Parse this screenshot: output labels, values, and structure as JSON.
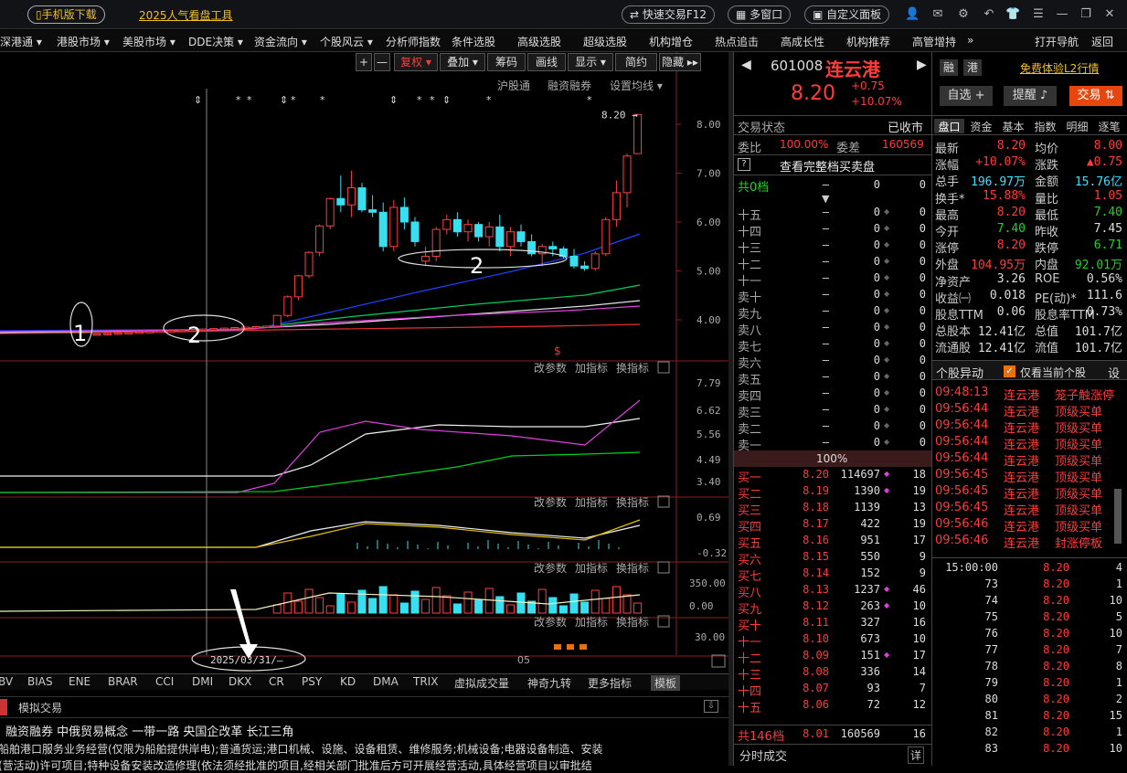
{
  "topbar": {
    "mobile_download": "手机版下载",
    "hot_tool": "2025人气看盘工具",
    "quick_trade": "快速交易F12",
    "multi_window": "多窗口",
    "custom_panel": "自定义面板"
  },
  "menu": [
    "深港通 ▾",
    "港股市场 ▾",
    "美股市场 ▾",
    "DDE决策 ▾",
    "资金流向 ▾",
    "个股风云 ▾",
    "分析师指数",
    "条件选股",
    "高级选股",
    "超级选股",
    "机构增仓",
    "热点追击",
    "高成长性",
    "机构推荐",
    "高管增持"
  ],
  "menu_more": "»",
  "open_nav": "打开导航",
  "back": "返回",
  "toolbar": [
    "复权 ▾",
    "叠加 ▾",
    "筹码",
    "画线",
    "显示 ▾",
    "简约",
    "隐藏 ▸▸"
  ],
  "chart_top_labels": {
    "hgt": "沪股通",
    "rzrq": "融资融券",
    "ma_setting": "设置均线 ▾"
  },
  "sub_labels": [
    "改参数",
    "加指标",
    "换指标"
  ],
  "price_axis": [
    "8.00",
    "7.00",
    "6.00",
    "5.00",
    "4.00"
  ],
  "current_price_label": "8.20",
  "ind1_axis": [
    "7.79",
    "6.62",
    "5.56",
    "4.49",
    "3.40"
  ],
  "ind2_axis": [
    "0.69",
    "-0.32"
  ],
  "ind3_axis": [
    "350.00",
    "0.00"
  ],
  "ind4_axis": [
    "30.00"
  ],
  "annotations": {
    "a1": "1",
    "a2": "2",
    "a3": "2"
  },
  "date_axis": {
    "start": "2025/03/31/—",
    "mid": "05"
  },
  "bottom_tabs": [
    "BV",
    "BIAS",
    "ENE",
    "BRAR",
    "CCI",
    "DMI",
    "DKX",
    "CR",
    "PSY",
    "KD",
    "DMA",
    "TRIX",
    "虚拟成交量",
    "神奇九转",
    "更多指标",
    "模板"
  ],
  "lower": {
    "tab": "模拟交易",
    "concepts": "融资融券  中俄贸易概念  一带一路  央国企改革  长江三角",
    "business": "船舶港口服务业务经营(仅限为船舶提供岸电);普通货运;港口机械、设施、设备租赁、维修服务;机械设备;电器设备制造、安装",
    "business2": "(营活动)许可项目;特种设备安装改造修理(依法须经批准的项目,经相关部门批准后方可开展经营活动,具体经营项目以审批结"
  },
  "stock": {
    "code": "601008",
    "name": "连云港",
    "price": "8.20",
    "change": "+0.75",
    "pct": "+10.07%",
    "free_l2": "免费体验L2行情",
    "rong": "融",
    "gang": "港",
    "zixuan": "自选 +",
    "tixing": "提醒",
    "jiaoyi": "交易"
  },
  "status": {
    "label": "交易状态",
    "value": "已收市",
    "weibi_l": "委比",
    "weibi": "100.00%",
    "weicha_l": "委差",
    "weicha": "160569",
    "full": "查看完整档买卖盘",
    "gong": "共0档",
    "gong_v1": "—",
    "gong_v2": "0",
    "gong_v3": "0"
  },
  "sells": [
    [
      "十五",
      "—",
      "0",
      "0"
    ],
    [
      "十四",
      "—",
      "0",
      "0"
    ],
    [
      "十三",
      "—",
      "0",
      "0"
    ],
    [
      "十二",
      "—",
      "0",
      "0"
    ],
    [
      "十一",
      "—",
      "0",
      "0"
    ],
    [
      "卖十",
      "—",
      "0",
      "0"
    ],
    [
      "卖九",
      "—",
      "0",
      "0"
    ],
    [
      "卖八",
      "—",
      "0",
      "0"
    ],
    [
      "卖七",
      "—",
      "0",
      "0"
    ],
    [
      "卖六",
      "—",
      "0",
      "0"
    ],
    [
      "卖五",
      "—",
      "0",
      "0"
    ],
    [
      "卖四",
      "—",
      "0",
      "0"
    ],
    [
      "卖三",
      "—",
      "0",
      "0"
    ],
    [
      "卖二",
      "—",
      "0",
      "0"
    ],
    [
      "卖一",
      "—",
      "0",
      "0"
    ]
  ],
  "mid_pct": "100%",
  "buys": [
    [
      "买一",
      "8.20",
      "114697",
      "18"
    ],
    [
      "买二",
      "8.19",
      "1390",
      "19"
    ],
    [
      "买三",
      "8.18",
      "1139",
      "13"
    ],
    [
      "买四",
      "8.17",
      "422",
      "19"
    ],
    [
      "买五",
      "8.16",
      "951",
      "17"
    ],
    [
      "买六",
      "8.15",
      "550",
      "9"
    ],
    [
      "买七",
      "8.14",
      "152",
      "9"
    ],
    [
      "买八",
      "8.13",
      "1237",
      "46"
    ],
    [
      "买九",
      "8.12",
      "263",
      "10"
    ],
    [
      "买十",
      "8.11",
      "327",
      "16"
    ],
    [
      "十一",
      "8.10",
      "673",
      "10"
    ],
    [
      "十二",
      "8.09",
      "151",
      "17"
    ],
    [
      "十三",
      "8.08",
      "336",
      "14"
    ],
    [
      "十四",
      "8.07",
      "93",
      "7"
    ],
    [
      "十五",
      "8.06",
      "72",
      "12"
    ]
  ],
  "buy_total": {
    "label": "共146档",
    "price": "8.01",
    "vol": "160569",
    "n": "16"
  },
  "fenshi": "分时成交",
  "xiang": "详",
  "right_tabs": [
    "盘口",
    "资金",
    "基本",
    "指数",
    "明细",
    "逐笔"
  ],
  "quote": [
    [
      "最新",
      "8.20",
      "均价",
      "8.00"
    ],
    [
      "涨幅",
      "+10.07%",
      "涨跌",
      "▲0.75"
    ],
    [
      "总手",
      "196.97万",
      "金额",
      "15.76亿"
    ],
    [
      "换手*",
      "15.88%",
      "量比",
      "1.05"
    ],
    [
      "最高",
      "8.20",
      "最低",
      "7.40"
    ],
    [
      "今开",
      "7.40",
      "昨收",
      "7.45"
    ],
    [
      "涨停",
      "8.20",
      "跌停",
      "6.71"
    ],
    [
      "外盘",
      "104.95万",
      "内盘",
      "92.01万"
    ],
    [
      "净资产",
      "3.26",
      "ROE",
      "0.56%"
    ],
    [
      "收益㈠",
      "0.018",
      "PE(动)*",
      "111.6"
    ],
    [
      "股息TTM",
      "0.06",
      "股息率TTM",
      "0.73%"
    ],
    [
      "总股本",
      "12.41亿",
      "总值",
      "101.7亿"
    ],
    [
      "流通股",
      "12.41亿",
      "流值",
      "101.7亿"
    ]
  ],
  "anomaly": {
    "title": "个股异动",
    "check": "仅看当前个股",
    "set": "设"
  },
  "anomaly_rows": [
    [
      "09:48:13",
      "连云港",
      "笼子触涨停"
    ],
    [
      "09:56:44",
      "连云港",
      "顶级买单"
    ],
    [
      "09:56:44",
      "连云港",
      "顶级买单"
    ],
    [
      "09:56:44",
      "连云港",
      "顶级买单"
    ],
    [
      "09:56:44",
      "连云港",
      "顶级买单"
    ],
    [
      "09:56:45",
      "连云港",
      "顶级买单"
    ],
    [
      "09:56:45",
      "连云港",
      "顶级买单"
    ],
    [
      "09:56:45",
      "连云港",
      "顶级买单"
    ],
    [
      "09:56:46",
      "连云港",
      "顶级买单"
    ],
    [
      "09:56:46",
      "连云港",
      "封涨停板"
    ]
  ],
  "ticks": [
    [
      "15:00:00",
      "8.20",
      "4"
    ],
    [
      "73",
      "8.20",
      "1"
    ],
    [
      "74",
      "8.20",
      "10"
    ],
    [
      "75",
      "8.20",
      "5"
    ],
    [
      "76",
      "8.20",
      "10"
    ],
    [
      "77",
      "8.20",
      "7"
    ],
    [
      "78",
      "8.20",
      "8"
    ],
    [
      "79",
      "8.20",
      "1"
    ],
    [
      "80",
      "8.20",
      "2"
    ],
    [
      "81",
      "8.20",
      "15"
    ],
    [
      "82",
      "8.20",
      "1"
    ],
    [
      "83",
      "8.20",
      "10"
    ]
  ],
  "chart_data": {
    "type": "candlestick",
    "candles": [
      [
        3.7,
        3.72,
        3.69,
        3.71
      ],
      [
        3.71,
        3.73,
        3.7,
        3.72
      ],
      [
        3.72,
        3.74,
        3.71,
        3.73
      ],
      [
        3.73,
        3.75,
        3.72,
        3.74
      ],
      [
        3.74,
        3.76,
        3.73,
        3.75
      ],
      [
        3.75,
        3.77,
        3.74,
        3.76
      ],
      [
        3.76,
        3.78,
        3.75,
        3.77
      ],
      [
        3.77,
        3.79,
        3.76,
        3.78
      ],
      [
        3.78,
        3.8,
        3.77,
        3.79
      ],
      [
        3.79,
        3.81,
        3.78,
        3.8
      ],
      [
        3.8,
        3.82,
        3.79,
        3.81
      ],
      [
        3.81,
        3.83,
        3.8,
        3.82
      ],
      [
        3.82,
        3.84,
        3.81,
        3.83
      ],
      [
        3.83,
        3.85,
        3.82,
        3.84
      ],
      [
        3.84,
        3.86,
        3.83,
        3.85
      ],
      [
        3.85,
        3.87,
        3.84,
        3.86
      ],
      [
        3.86,
        3.88,
        3.85,
        3.87
      ],
      [
        3.87,
        4.1,
        3.86,
        4.09
      ],
      [
        4.09,
        4.5,
        4.05,
        4.47
      ],
      [
        4.47,
        4.92,
        4.4,
        4.9
      ],
      [
        4.9,
        5.4,
        4.85,
        5.38
      ],
      [
        5.38,
        5.95,
        5.3,
        5.92
      ],
      [
        5.92,
        6.5,
        5.85,
        6.48
      ],
      [
        6.48,
        6.95,
        6.2,
        6.35
      ],
      [
        6.35,
        7.05,
        6.1,
        6.7
      ],
      [
        6.7,
        6.8,
        6.2,
        6.25
      ],
      [
        6.25,
        6.55,
        6.1,
        6.2
      ],
      [
        6.2,
        6.4,
        5.4,
        5.5
      ],
      [
        5.5,
        6.45,
        5.4,
        6.3
      ],
      [
        6.3,
        6.5,
        5.85,
        6.0
      ],
      [
        6.0,
        6.1,
        5.5,
        5.6
      ],
      [
        5.2,
        5.5,
        5.1,
        5.3
      ],
      [
        5.3,
        5.9,
        5.2,
        5.85
      ],
      [
        5.85,
        6.15,
        5.75,
        6.05
      ],
      [
        6.05,
        6.2,
        5.7,
        5.8
      ],
      [
        5.8,
        6.05,
        5.6,
        5.95
      ],
      [
        5.95,
        6.0,
        5.6,
        5.7
      ],
      [
        5.7,
        6.0,
        5.5,
        5.9
      ],
      [
        5.9,
        6.15,
        5.4,
        5.5
      ],
      [
        5.5,
        5.9,
        5.3,
        5.8
      ],
      [
        5.8,
        5.95,
        5.5,
        5.6
      ],
      [
        5.6,
        5.75,
        5.3,
        5.35
      ],
      [
        5.35,
        5.55,
        5.1,
        5.5
      ],
      [
        5.5,
        5.6,
        5.3,
        5.45
      ],
      [
        5.45,
        5.5,
        5.25,
        5.3
      ],
      [
        5.3,
        5.45,
        5.05,
        5.1
      ],
      [
        5.1,
        5.2,
        5.0,
        5.05
      ],
      [
        5.05,
        5.4,
        5.0,
        5.35
      ],
      [
        5.35,
        6.1,
        5.3,
        6.05
      ],
      [
        6.05,
        6.85,
        5.9,
        6.6
      ],
      [
        6.6,
        7.4,
        6.3,
        7.35
      ],
      [
        7.4,
        8.2,
        7.4,
        8.2
      ]
    ]
  }
}
